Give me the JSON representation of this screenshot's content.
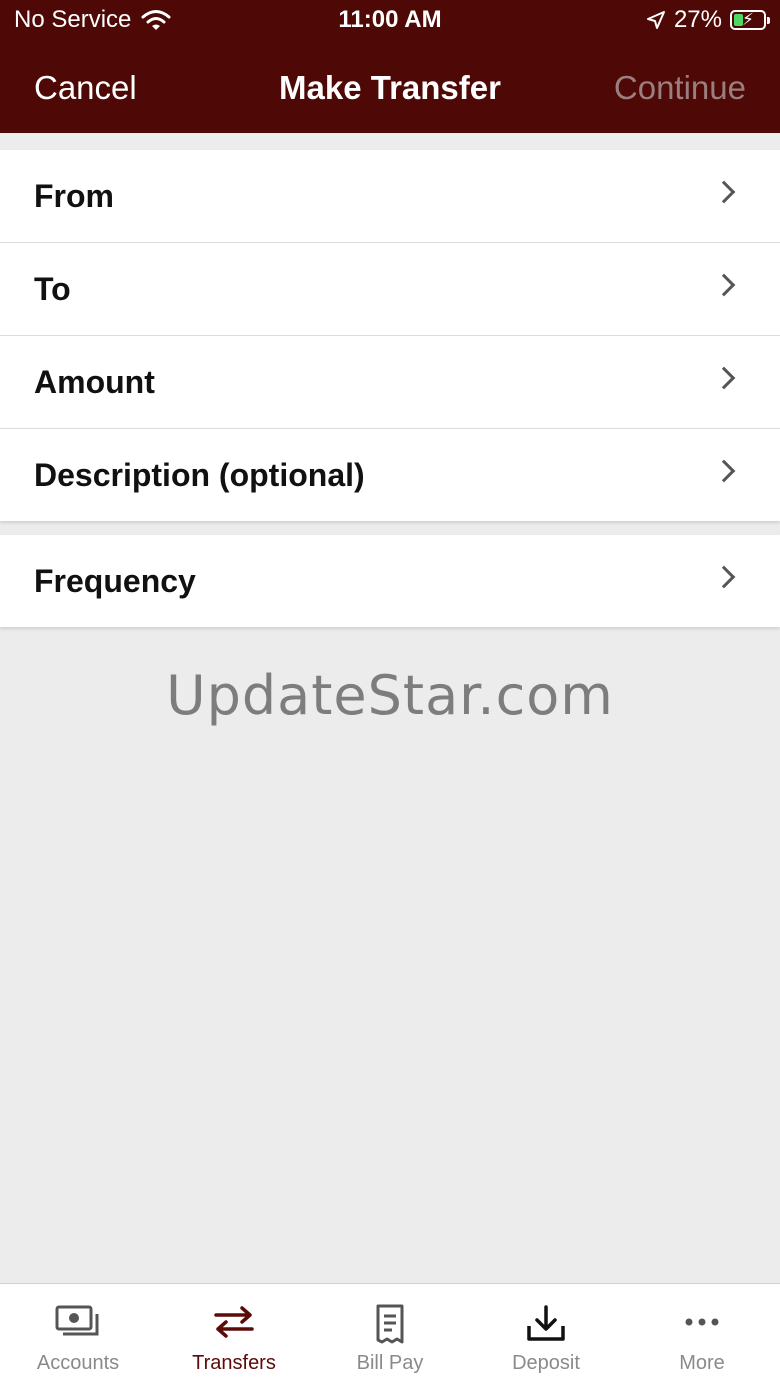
{
  "status_bar": {
    "carrier": "No Service",
    "time": "11:00 AM",
    "battery_percent": "27%"
  },
  "nav": {
    "cancel": "Cancel",
    "title": "Make Transfer",
    "continue": "Continue"
  },
  "form_rows": [
    "From",
    "To",
    "Amount",
    "Description (optional)"
  ],
  "frequency_row": "Frequency",
  "watermark": "UpdateStar.com",
  "tabs": [
    {
      "label": "Accounts",
      "icon": "accounts-icon"
    },
    {
      "label": "Transfers",
      "icon": "transfers-icon"
    },
    {
      "label": "Bill Pay",
      "icon": "bill-pay-icon"
    },
    {
      "label": "Deposit",
      "icon": "deposit-icon"
    },
    {
      "label": "More",
      "icon": "more-icon"
    }
  ],
  "active_tab": "Transfers",
  "colors": {
    "header": "#4e0806",
    "accent": "#5b0b08",
    "background": "#ececec",
    "battery_charge": "#4cd964"
  }
}
